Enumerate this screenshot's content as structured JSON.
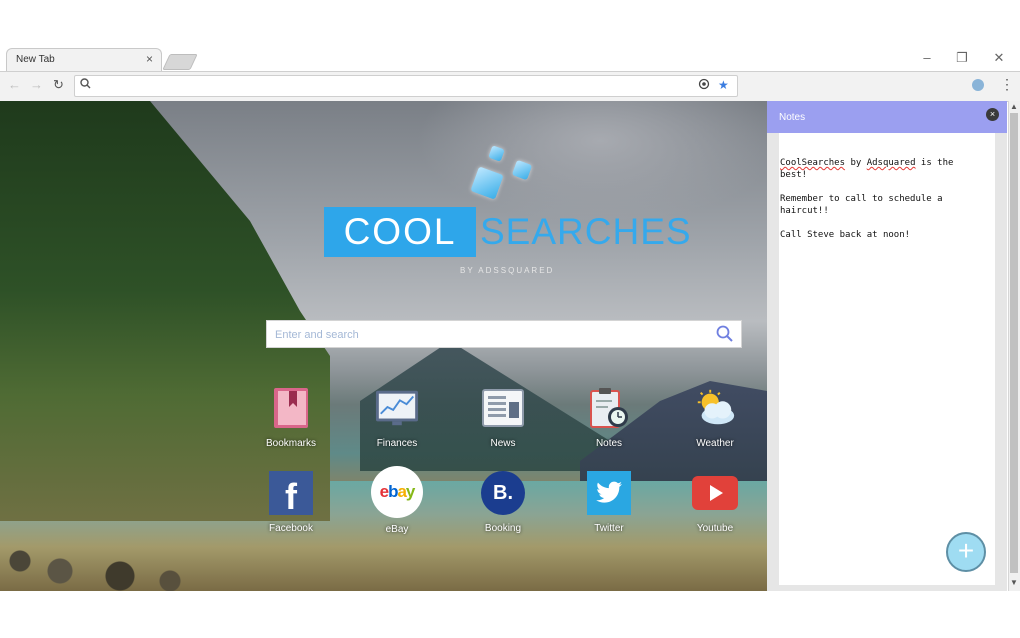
{
  "browser": {
    "tab_title": "New Tab",
    "tab_close": "×",
    "window_minimize": "–",
    "window_restore": "❐",
    "window_close": "✕",
    "address_value": "",
    "menu_dots": "⋮"
  },
  "logo": {
    "cool": "COOL",
    "searches": "SEARCHES",
    "by": "BY ADSSQUARED"
  },
  "search": {
    "placeholder": "Enter and search"
  },
  "tiles_row1": [
    {
      "label": "Bookmarks",
      "icon": "bookmark-book-icon"
    },
    {
      "label": "Finances",
      "icon": "chart-monitor-icon"
    },
    {
      "label": "News",
      "icon": "newspaper-icon"
    },
    {
      "label": "Notes",
      "icon": "clipboard-clock-icon"
    },
    {
      "label": "Weather",
      "icon": "sun-cloud-icon"
    }
  ],
  "tiles_row2": [
    {
      "label": "Facebook",
      "icon": "facebook-icon",
      "glyph": "f"
    },
    {
      "label": "eBay",
      "icon": "ebay-icon",
      "glyph": "ebay"
    },
    {
      "label": "Booking",
      "icon": "booking-icon",
      "glyph": "B."
    },
    {
      "label": "Twitter",
      "icon": "twitter-icon"
    },
    {
      "label": "Youtube",
      "icon": "youtube-icon"
    }
  ],
  "notes": {
    "title": "Notes",
    "close_glyph": "×",
    "line1_a": "CoolSearches",
    "line1_b": " by ",
    "line1_c": "Adsquared",
    "line1_d": " is the best!",
    "line2": "Remember to call to schedule a haircut!!",
    "line3": "Call Steve back at noon!",
    "add_glyph": "+"
  },
  "colors": {
    "logo_blue": "#2ea6ea",
    "notes_header": "#9b9ff0"
  }
}
